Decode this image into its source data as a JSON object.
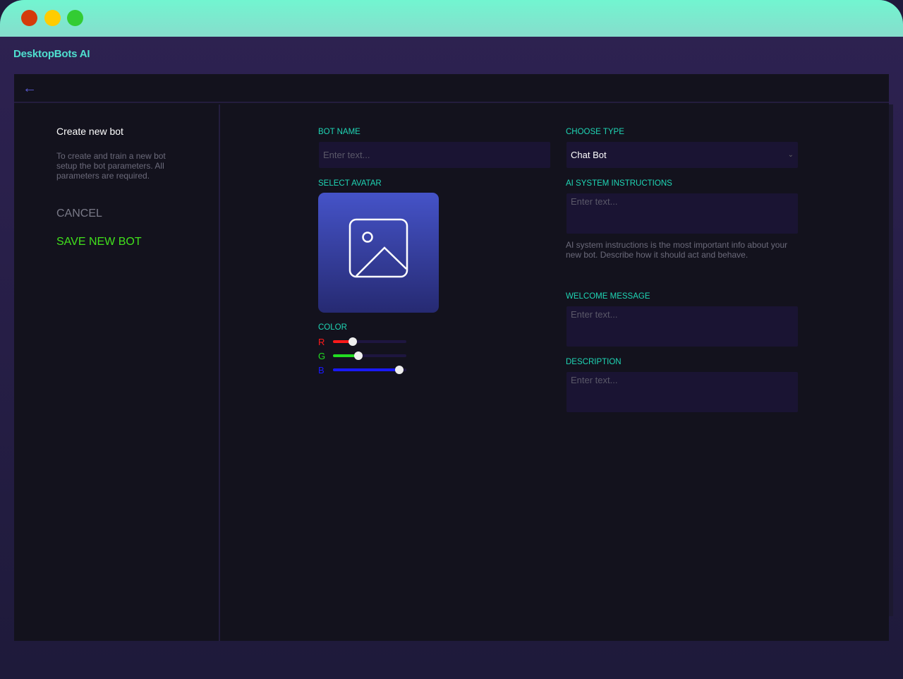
{
  "app": {
    "title": "DesktopBots AI"
  },
  "window_controls": [
    {
      "name": "close",
      "color": "#d43b0a"
    },
    {
      "name": "minimize",
      "color": "#ffcc00"
    },
    {
      "name": "maximize",
      "color": "#33cc33"
    }
  ],
  "sidebar": {
    "title": "Create new bot",
    "description": "To create and train a new bot setup the bot parameters. All parameters are required.",
    "cancel_label": "CANCEL",
    "save_label": "SAVE NEW BOT"
  },
  "form": {
    "bot_name": {
      "label": "BOT NAME",
      "placeholder": "Enter text...",
      "value": ""
    },
    "choose_type": {
      "label": "CHOOSE TYPE",
      "value": "Chat Bot"
    },
    "avatar": {
      "label": "SELECT AVATAR",
      "icon": "image-icon"
    },
    "system_instructions": {
      "label": "AI SYSTEM INSTRUCTIONS",
      "placeholder": "Enter text...",
      "help": "AI system instructions is the most important info about your new bot. Describe how it should act and behave."
    },
    "welcome_message": {
      "label": "WELCOME MESSAGE",
      "placeholder": "Enter text..."
    },
    "description": {
      "label": "DESCRIPTION",
      "placeholder": "Enter text..."
    },
    "color": {
      "label": "COLOR",
      "sliders": [
        {
          "label": "R",
          "value": 0.27,
          "color": "#ff1a1a"
        },
        {
          "label": "G",
          "value": 0.35,
          "color": "#22dd22"
        },
        {
          "label": "B",
          "value": 0.9,
          "color": "#1a1aff"
        }
      ]
    }
  },
  "colors": {
    "accent": "#1fd6b5",
    "save": "#41e01c",
    "brand": "#4fe0cf"
  }
}
